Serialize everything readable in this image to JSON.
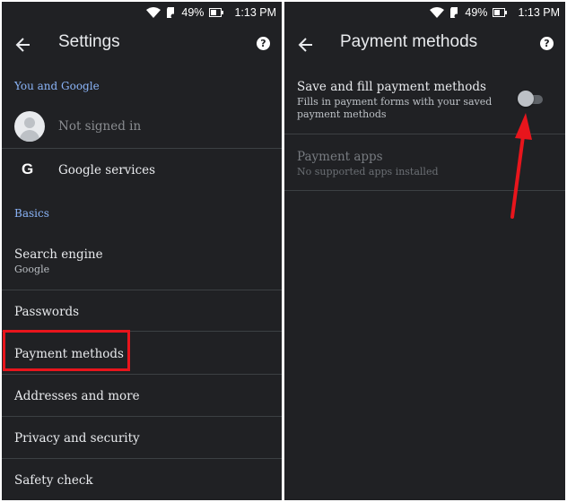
{
  "status_bar": {
    "battery_pct": "49%",
    "time": "1:13 PM"
  },
  "left": {
    "title": "Settings",
    "help": "?",
    "section_you": "You and Google",
    "not_signed_in": "Not signed in",
    "google_services": "Google services",
    "google_icon_glyph": "G",
    "section_basics": "Basics",
    "search_engine": {
      "label": "Search engine",
      "value": "Google"
    },
    "items": [
      "Passwords",
      "Payment methods",
      "Addresses and more",
      "Privacy and security",
      "Safety check"
    ]
  },
  "right": {
    "title": "Payment methods",
    "help": "?",
    "save_fill": {
      "label": "Save and fill payment methods",
      "desc_line1": "Fills in payment forms with your saved",
      "desc_line2": "payment methods",
      "toggle_on": false
    },
    "payment_apps": {
      "label": "Payment apps",
      "desc": "No supported apps installed"
    }
  },
  "colors": {
    "highlight": "#e8151c",
    "section_header": "#8ab4f8",
    "background": "#202124"
  },
  "icons": [
    "wifi-icon",
    "sd-card-icon",
    "battery-icon",
    "back-arrow-icon",
    "help-icon",
    "google-g-icon",
    "avatar-icon",
    "red-arrow-annotation"
  ]
}
